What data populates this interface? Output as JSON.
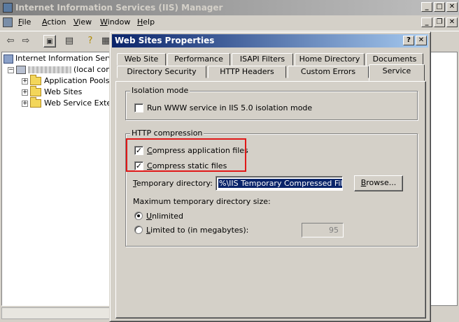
{
  "main_window": {
    "title": "Internet Information Services (IIS) Manager",
    "menu": [
      {
        "label": "File",
        "accel": "F",
        "rest": "ile"
      },
      {
        "label": "Action",
        "accel": "A",
        "rest": "ction"
      },
      {
        "label": "View",
        "accel": "V",
        "rest": "iew"
      },
      {
        "label": "Window",
        "accel": "W",
        "rest": "indow"
      },
      {
        "label": "Help",
        "accel": "H",
        "rest": "elp"
      }
    ],
    "tree": {
      "root": "Internet Information Services",
      "computer_suffix": "(local computer)",
      "items": [
        "Application Pools",
        "Web Sites",
        "Web Service Extensions"
      ]
    }
  },
  "dialog": {
    "title": "Web Sites Properties",
    "tabs_row1": [
      "Web Site",
      "Performance",
      "ISAPI Filters",
      "Home Directory",
      "Documents"
    ],
    "tabs_row2": [
      "Directory Security",
      "HTTP Headers",
      "Custom Errors",
      "Service"
    ],
    "active_tab": "Service",
    "isolation": {
      "legend": "Isolation mode",
      "option_label": "Run WWW service in IIS 5.0 isolation mode",
      "checked": false
    },
    "compression": {
      "legend": "HTTP compression",
      "app_files_label": {
        "accel": "C",
        "rest": "ompress application files"
      },
      "app_files_checked": true,
      "static_files_label": {
        "accel": "C",
        "rest": "ompress static files"
      },
      "static_files_checked": true,
      "temp_dir_label": "Temporary directory:",
      "temp_dir_accel": "T",
      "temp_dir_rest": "emporary directory:",
      "temp_dir_value": "%\\IIS Temporary Compressed Files",
      "browse_label": "Browse...",
      "browse_accel": "B",
      "browse_rest": "rowse...",
      "max_size_label": "Maximum temporary directory size:",
      "unlimited_label": {
        "accel": "U",
        "rest": "nlimited"
      },
      "unlimited_checked": true,
      "limited_label": {
        "accel": "L",
        "rest": "imited to (in megabytes):"
      },
      "limited_checked": false,
      "limit_value": "95"
    }
  },
  "colors": {
    "dialog_title_start": "#0a246a",
    "dialog_title_end": "#a6caf0",
    "highlight": "#e01818",
    "face": "#d4d0c8"
  }
}
